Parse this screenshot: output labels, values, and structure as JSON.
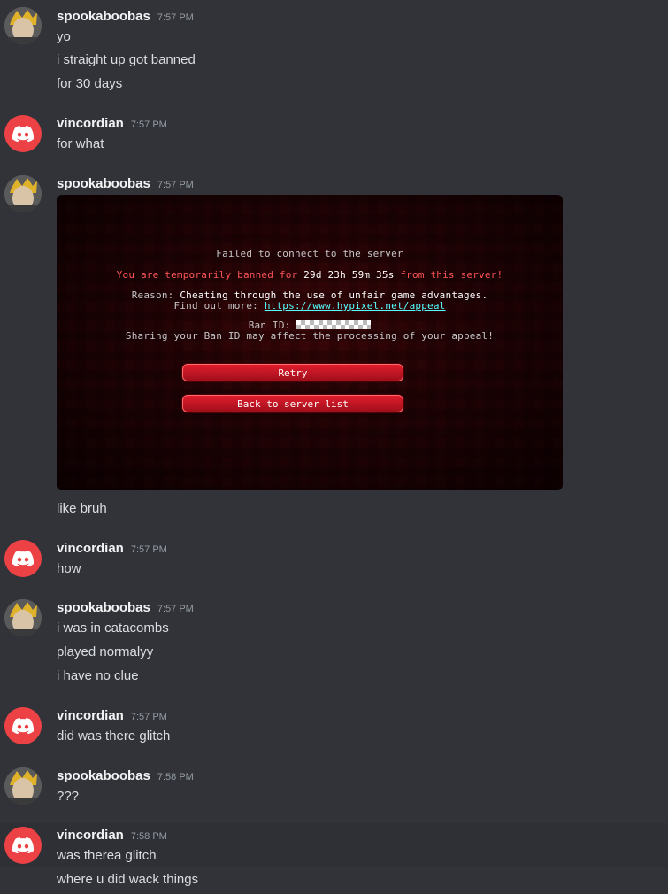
{
  "users": {
    "spook": "spookaboobas",
    "vinc": "vincordian"
  },
  "messages": [
    {
      "user": "spookaboobas",
      "time": "7:57 PM",
      "lines": [
        "yo",
        "i straight up got banned",
        "for 30 days"
      ]
    },
    {
      "user": "vincordian",
      "time": "7:57 PM",
      "lines": [
        "for what"
      ]
    },
    {
      "user": "spookaboobas",
      "time": "7:57 PM",
      "lines": [
        "like bruh"
      ]
    },
    {
      "user": "vincordian",
      "time": "7:57 PM",
      "lines": [
        "how"
      ]
    },
    {
      "user": "spookaboobas",
      "time": "7:57 PM",
      "lines": [
        "i was in catacombs",
        "played normalyy",
        "i have no clue"
      ]
    },
    {
      "user": "vincordian",
      "time": "7:57 PM",
      "lines": [
        "did was there glitch"
      ]
    },
    {
      "user": "spookaboobas",
      "time": "7:58 PM",
      "lines": [
        "???"
      ]
    },
    {
      "user": "vincordian",
      "time": "7:58 PM",
      "lines": [
        "was therea glitch",
        "where u did wack things"
      ]
    }
  ],
  "embed": {
    "title": "Failed to connect to the server",
    "ban_prefix": "You are temporarily banned for ",
    "ban_duration": "29d 23h 59m 35s",
    "ban_suffix": " from this server!",
    "reason_label": "Reason: ",
    "reason_text": "Cheating through the use of unfair game advantages.",
    "findout_label": "Find out more: ",
    "findout_link": "https://www.hypixel.net/appeal",
    "banid_label": "Ban ID: ",
    "warning": "Sharing your Ban ID may affect the processing of your appeal!",
    "retry_button": "Retry",
    "back_button": "Back to server list"
  },
  "colors": {
    "background": "#313338",
    "discord_red": "#ed4245",
    "mc_red": "#ff5555",
    "mc_link": "#55ffff"
  }
}
